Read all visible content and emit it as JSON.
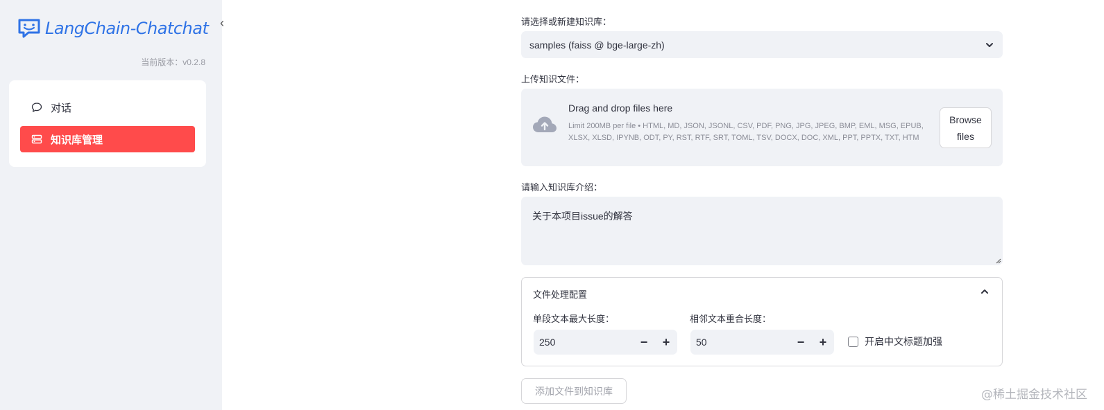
{
  "sidebar": {
    "app_title": "LangChain-Chatchat",
    "version": "当前版本：v0.2.8",
    "collapse_icon": "‹",
    "items": [
      {
        "label": "对话",
        "icon": "chat-bubble-icon"
      },
      {
        "label": "知识库管理",
        "icon": "database-icon",
        "active": true
      }
    ]
  },
  "main": {
    "kb_select": {
      "label": "请选择或新建知识库：",
      "value": "samples (faiss @ bge-large-zh)"
    },
    "upload": {
      "label": "上传知识文件：",
      "title": "Drag and drop files here",
      "limit": "Limit 200MB per file • HTML, MD, JSON, JSONL, CSV, PDF, PNG, JPG, JPEG, BMP, EML, MSG, EPUB, XLSX, XLSD, IPYNB, ODT, PY, RST, RTF, SRT, TOML, TSV, DOCX, DOC, XML, PPT, PPTX, TXT, HTM",
      "browse_line1": "Browse",
      "browse_line2": "files"
    },
    "intro": {
      "label": "请输入知识库介绍：",
      "value": "关于本项目issue的解答"
    },
    "config": {
      "title": "文件处理配置",
      "chunk_size_label": "单段文本最大长度：",
      "chunk_size": "250",
      "overlap_label": "相邻文本重合长度：",
      "overlap": "50",
      "minus": "−",
      "plus": "+",
      "zh_title_label": "开启中文标题加强"
    },
    "submit_label": "添加文件到知识库"
  },
  "watermark": "@稀土掘金技术社区",
  "colors": {
    "accent": "#ff4b4b",
    "brand": "#2f73e6",
    "sidebar_bg": "#f0f2f6"
  }
}
